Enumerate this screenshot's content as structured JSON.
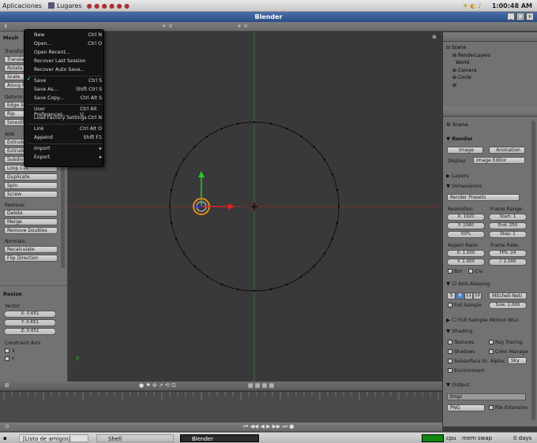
{
  "system_bar": {
    "apps": "Aplicaciones",
    "places": "Lugares",
    "clock": "1:00:48 AM"
  },
  "window": {
    "title": "Blender"
  },
  "file_menu": {
    "items": [
      {
        "label": "New",
        "shortcut": "Ctrl N"
      },
      {
        "label": "Open...",
        "shortcut": "Ctrl O"
      },
      {
        "label": "Open Recent...",
        "shortcut": ""
      },
      {
        "label": "Recover Last Session",
        "shortcut": ""
      },
      {
        "label": "Recover Auto Save...",
        "shortcut": ""
      },
      {
        "label": "Save",
        "shortcut": "Ctrl S"
      },
      {
        "label": "Save As...",
        "shortcut": "Shift Ctrl S"
      },
      {
        "label": "Save Copy...",
        "shortcut": "Ctrl Alt S"
      },
      {
        "label": "User Preferences...",
        "shortcut": "Ctrl Alt U"
      },
      {
        "label": "Load Factory Settings",
        "shortcut": "Ctrl N"
      },
      {
        "label": "Link",
        "shortcut": "Ctrl Alt O"
      },
      {
        "label": "Append",
        "shortcut": "Shift F1"
      },
      {
        "label": "Import",
        "shortcut": "▸"
      },
      {
        "label": "Export",
        "shortcut": "▸"
      }
    ]
  },
  "tools": {
    "header": "Mesh",
    "transform_label": "Transform:",
    "transform": [
      "Translate",
      "Rotate",
      "Scale",
      "Along N"
    ],
    "deform_label": "Deform:",
    "deform": [
      "Edge Sl",
      "Rip",
      "Smooth V"
    ],
    "add_label": "Add:",
    "add": [
      "Extrude R",
      "Extrude I",
      "Subdivid",
      "Loop Cut",
      "Duplicate",
      "Spin",
      "Screw"
    ],
    "remove_label": "Remove:",
    "remove": [
      "Delete",
      "Merge",
      "Remove Doubles"
    ],
    "normals_label": "Normals:",
    "normals": [
      "Recalculate",
      "Flip Direction"
    ]
  },
  "resize": {
    "header": "Resize",
    "vector_label": "Vector",
    "x": "X: 0.651",
    "y": "Y: 0.651",
    "z": "Z: 0.651",
    "constraint_label": "Constraint Axis",
    "cx": "X",
    "cy": "Y"
  },
  "outliner": {
    "items": [
      "Scene",
      "RenderLayers",
      "World",
      "Camera",
      "Circle",
      ""
    ]
  },
  "properties": {
    "scene": "Scene",
    "render_header": "Render",
    "image_btn": "Image",
    "animation_btn": "Animation",
    "display_label": "Display:",
    "display_value": "Image Editor",
    "layers": "Layers",
    "dimensions": "Dimensions",
    "render_presets": "Render Presets",
    "resolution": "Resolution:",
    "res_x": "X: 1920",
    "res_y": "Y: 1080",
    "res_pct": "50%",
    "frame_range": "Frame Range:",
    "start": "Start: 1",
    "end": "End: 250",
    "step": "Step: 1",
    "aspect": "Aspect Ratio:",
    "asp_x": "X: 1.000",
    "asp_y": "Y: 1.000",
    "frame_rate": "Frame Rate:",
    "fps": "FPS: 24",
    "fbase": "/: 1.000",
    "bor": "Bor",
    "cro": "Cro",
    "antialias": "Anti-Aliasing",
    "aa_5": "5",
    "aa_8": "8",
    "aa_11": "11",
    "aa_16": "16",
    "filter": "Mitchell-Netr",
    "full_sample": "Full Sample",
    "size": "Size: 1.000",
    "motion_blur": "Full Sample Motion Blur",
    "shading": "Shading",
    "textures": "Textures",
    "ray": "Ray Tracing",
    "shadows": "Shadows",
    "color_manage": "Color Manage",
    "sss": "Subsurface Sc",
    "alpha_label": "Alpha:",
    "alpha_value": "Sky",
    "environment": "Environment",
    "output": "Output",
    "path": "/tmp/",
    "format": "PNG",
    "file_ext": "File Extension"
  },
  "taskbar": {
    "t1": "[Lista de amigos]",
    "t2": "Shell",
    "t3": "Blender",
    "cpu": "cpu",
    "mem": "mem",
    "swap": "swap",
    "days": "0 days"
  }
}
